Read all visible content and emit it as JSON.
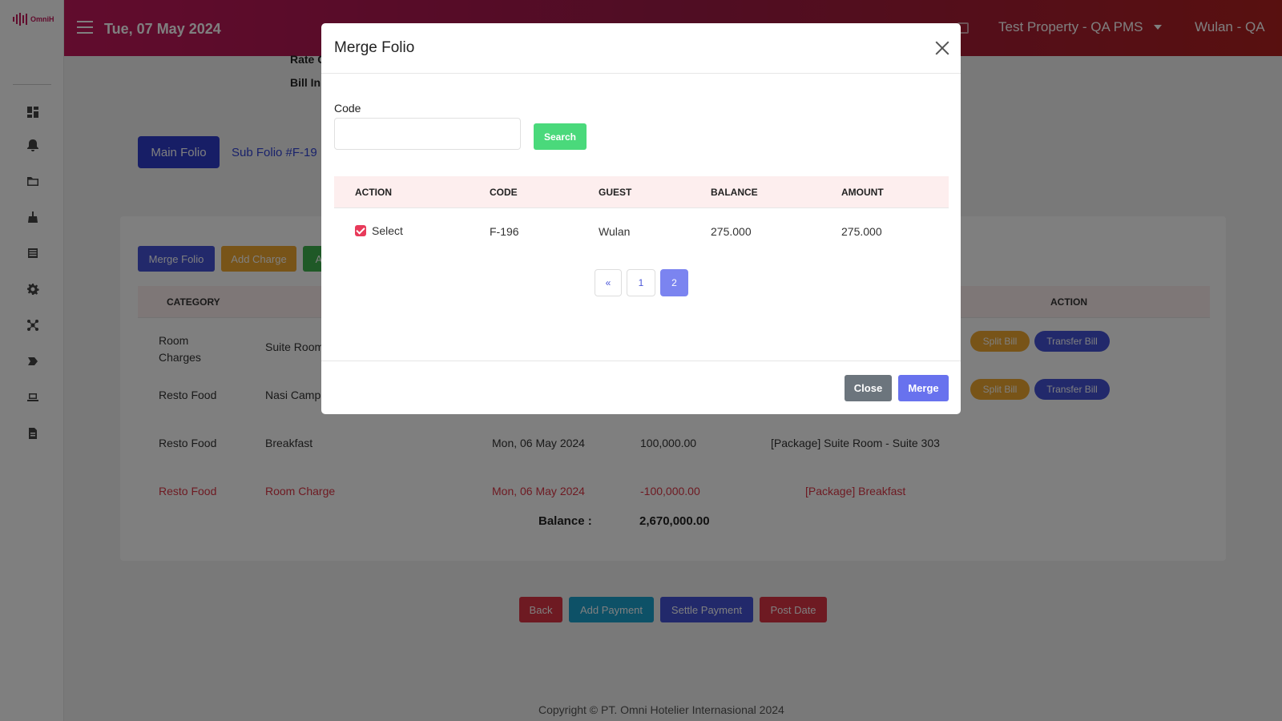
{
  "app": {
    "logo_text": "OmniH"
  },
  "header": {
    "date": "Tue, 07 May 2024",
    "property": "Test Property - QA PMS",
    "user": "Wulan - QA"
  },
  "sidebar": {
    "icons": [
      "dashboard-icon",
      "bell-icon",
      "folder-icon",
      "cleaning-icon",
      "list-icon",
      "gear-icon",
      "network-icon",
      "tag-icon",
      "laptop-icon",
      "document-icon"
    ]
  },
  "page": {
    "info_labels": [
      "Rate C",
      "Bill In"
    ],
    "tabs": {
      "main": "Main Folio",
      "sub": "Sub Folio #F-19"
    },
    "action_buttons": {
      "merge": "Merge Folio",
      "add_charge": "Add Charge",
      "third": "A"
    },
    "table": {
      "headers": {
        "category": "CATEGORY",
        "action": "ACTION"
      },
      "rows": [
        {
          "category": "Room\nCharges",
          "description": "Suite Room",
          "date": "",
          "amount": "",
          "note": "",
          "split": "Split Bill",
          "transfer": "Transfer Bill"
        },
        {
          "category": "Resto Food",
          "description": "Nasi Camp",
          "date": "",
          "amount": "",
          "note": "",
          "split": "Split Bill",
          "transfer": "Transfer Bill"
        },
        {
          "category": "Resto Food",
          "description": "Breakfast",
          "date": "Mon, 06 May 2024",
          "amount": "100,000.00",
          "note": "[Package] Suite Room - Suite 303"
        },
        {
          "category": "Resto Food",
          "description": "Room Charge",
          "date": "Mon, 06 May 2024",
          "amount": "-100,000.00",
          "note": "[Package] Breakfast"
        }
      ]
    },
    "balance": {
      "label": "Balance :",
      "value": "2,670,000.00"
    },
    "bottom_buttons": {
      "back": "Back",
      "add_payment": "Add Payment",
      "settle_payment": "Settle Payment",
      "post_date": "Post Date"
    },
    "footer": "Copyright © PT. Omni Hotelier Internasional 2024"
  },
  "modal": {
    "title": "Merge Folio",
    "code_label": "Code",
    "code_value": "",
    "search_label": "Search",
    "table": {
      "headers": [
        "ACTION",
        "CODE",
        "GUEST",
        "BALANCE",
        "AMOUNT"
      ],
      "rows": [
        {
          "select": "Select",
          "checked": true,
          "code": "F-196",
          "guest": "Wulan",
          "balance": "275.000",
          "amount": "275.000"
        }
      ]
    },
    "pagination": {
      "prev": "«",
      "pages": [
        "1",
        "2"
      ],
      "active": "2"
    },
    "close_label": "Close",
    "merge_label": "Merge"
  },
  "colors": {
    "header_gradient": [
      "#c2185b",
      "#b0201f"
    ],
    "primary": "#2f3ccc",
    "merge_button": "#6872ee",
    "search_button": "#4ad97b",
    "checkbox": "#e83a5a",
    "danger_text": "#dc3545"
  }
}
